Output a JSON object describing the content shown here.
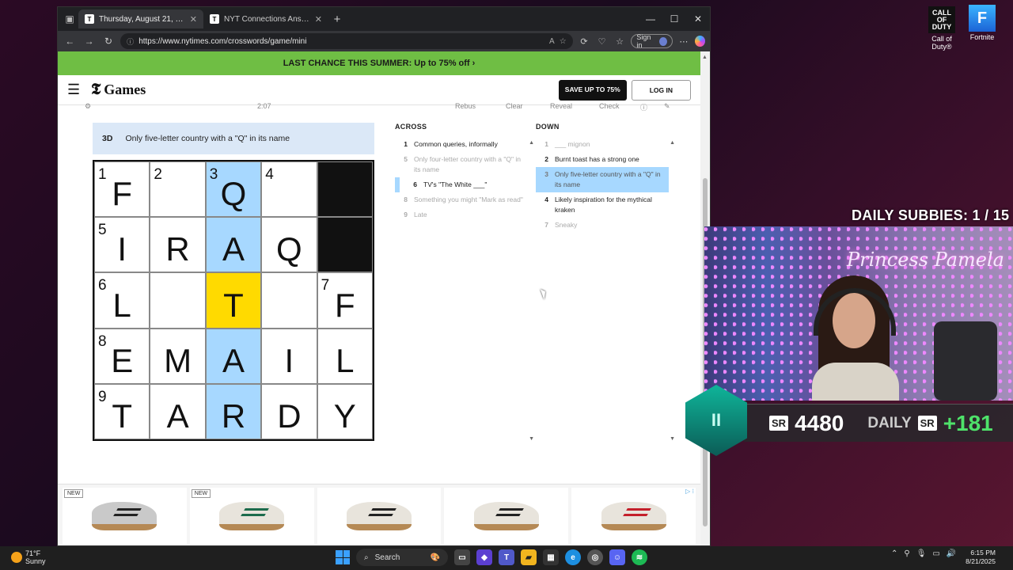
{
  "desktop_icons": [
    {
      "label": "Call of Duty®",
      "tile": "CALL OF DUTY"
    },
    {
      "label": "Fortnite",
      "tile": "F"
    }
  ],
  "browser": {
    "tabs": [
      {
        "title": "Thursday, August 21, 2025 The M",
        "active": true
      },
      {
        "title": "NYT Connections Answers for Au",
        "active": false
      }
    ],
    "url": "https://www.nytimes.com/crosswords/game/mini",
    "signin_label": "Sign in"
  },
  "page": {
    "promo": "LAST CHANCE THIS SUMMER:  Up to 75% off ›",
    "logo_t": "𝕿",
    "logo": "Games",
    "save_btn": "SAVE UP TO 75%",
    "login_btn": "LOG IN",
    "toolstrip": {
      "timer": "2:07",
      "rebus": "Rebus",
      "clear": "Clear",
      "reveal": "Reveal",
      "check": "Check"
    },
    "active_clue": {
      "num": "3D",
      "text": "Only five-letter country with a \"Q\" in its name"
    },
    "grid": [
      [
        {
          "n": "1",
          "l": "F"
        },
        {
          "n": "2",
          "l": ""
        },
        {
          "n": "3",
          "l": "Q",
          "s": "hl"
        },
        {
          "n": "4",
          "l": ""
        },
        {
          "black": true
        }
      ],
      [
        {
          "n": "5",
          "l": "I"
        },
        {
          "n": "",
          "l": "R"
        },
        {
          "n": "",
          "l": "A",
          "s": "hl"
        },
        {
          "n": "",
          "l": "Q"
        },
        {
          "black": true
        }
      ],
      [
        {
          "n": "6",
          "l": "L"
        },
        {
          "n": "",
          "l": ""
        },
        {
          "n": "",
          "l": "T",
          "s": "cur"
        },
        {
          "n": "",
          "l": ""
        },
        {
          "n": "7",
          "l": "F"
        }
      ],
      [
        {
          "n": "8",
          "l": "E"
        },
        {
          "n": "",
          "l": "M"
        },
        {
          "n": "",
          "l": "A",
          "s": "hl"
        },
        {
          "n": "",
          "l": "I"
        },
        {
          "n": "",
          "l": "L"
        }
      ],
      [
        {
          "n": "9",
          "l": "T"
        },
        {
          "n": "",
          "l": "A"
        },
        {
          "n": "",
          "l": "R",
          "s": "hl"
        },
        {
          "n": "",
          "l": "D"
        },
        {
          "n": "",
          "l": "Y"
        }
      ]
    ],
    "across_title": "ACROSS",
    "across": [
      {
        "n": "1",
        "text": "Common queries, informally",
        "state": ""
      },
      {
        "n": "5",
        "text": "Only four-letter country with a \"Q\" in its name",
        "state": "done"
      },
      {
        "n": "6",
        "text": "TV's \"The White ___\"",
        "state": "cross"
      },
      {
        "n": "8",
        "text": "Something you might \"Mark as read\"",
        "state": "done"
      },
      {
        "n": "9",
        "text": "Late",
        "state": "done"
      }
    ],
    "down_title": "DOWN",
    "down": [
      {
        "n": "1",
        "text": "___ mignon",
        "state": "done"
      },
      {
        "n": "2",
        "text": "Burnt toast has a strong one",
        "state": ""
      },
      {
        "n": "3",
        "text": "Only five-letter country with a \"Q\" in its name",
        "state": "sel"
      },
      {
        "n": "4",
        "text": "Likely inspiration for the mythical kraken",
        "state": ""
      },
      {
        "n": "7",
        "text": "Sneaky",
        "state": "done"
      }
    ],
    "ads": [
      {
        "badge": "NEW",
        "style": "silver"
      },
      {
        "badge": "NEW",
        "style": "green"
      },
      {
        "badge": "",
        "style": ""
      },
      {
        "badge": "",
        "style": ""
      },
      {
        "badge": "",
        "style": "red"
      }
    ]
  },
  "overlay": {
    "subbies": "DAILY SUBBIES:  1 / 15",
    "neon_sign": "Princess Pamela",
    "rank": "II",
    "sr_tag": "SR",
    "sr_value": "4480",
    "daily_label": "DAILY",
    "sr_delta": "+181"
  },
  "taskbar": {
    "temp": "71°F",
    "weather": "Sunny",
    "search": "Search",
    "time": "6:15 PM",
    "date": "8/21/2025"
  }
}
